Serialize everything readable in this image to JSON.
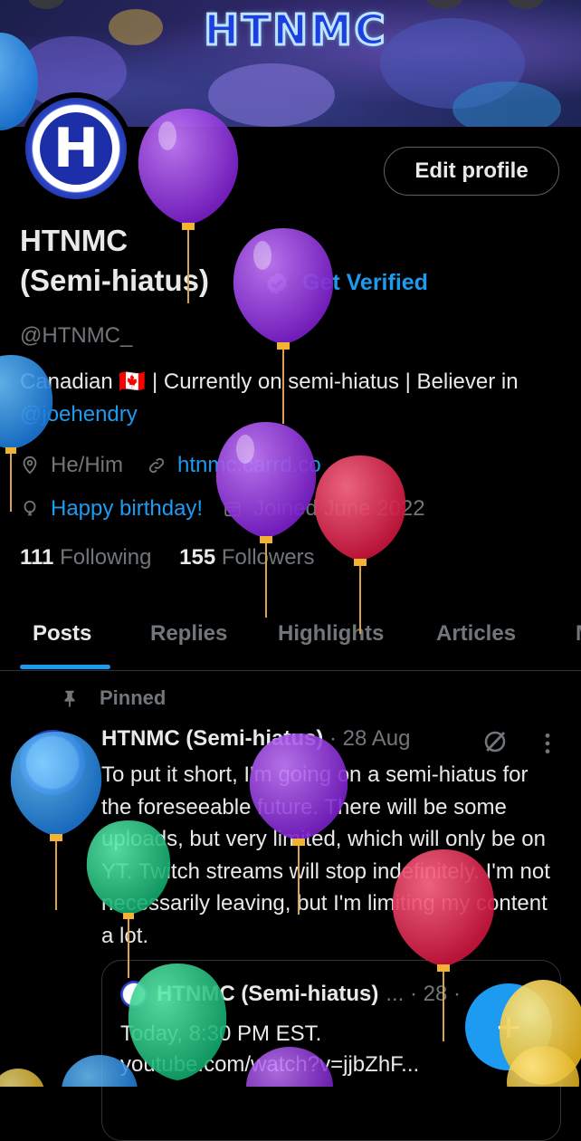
{
  "banner": {
    "logo_text": "HTNMC"
  },
  "profile": {
    "edit_button": "Edit profile",
    "name_line1": "HTNMC",
    "name_line2": "(Semi-hiatus)",
    "get_verified": "Get Verified",
    "handle": "@HTNMC_",
    "bio_prefix": "Canadian 🇨🇦 | Currently on semi-hiatus | Believer in ",
    "bio_mention": "@joehendry",
    "pronouns": "He/Him",
    "website": "htnmc.carrd.co",
    "birthday": "Happy birthday!",
    "joined": "Joined June 2022",
    "following_count": "111",
    "following_label": "Following",
    "followers_count": "155",
    "followers_label": "Followers"
  },
  "tabs": [
    "Posts",
    "Replies",
    "Highlights",
    "Articles",
    "M"
  ],
  "post": {
    "pinned_label": "Pinned",
    "author": "HTNMC (Semi-hiatus)",
    "date": "· 28 Aug",
    "text": "To put it short, I'm going on a semi-hiatus for the foreseeable future. There will be some uploads, but very limited, which will only be on YT. Twitch streams will stop indefinitely. I'm not necessarily leaving, but I'm limiting my content a lot.",
    "quote": {
      "author": "HTNMC (Semi-hiatus)",
      "meta": "... · 28 ·",
      "line1": "Today, 8:30 PM EST.",
      "line2": "youtube.com/watch?v=jjbZhF..."
    }
  },
  "fab_label": "+",
  "colors": {
    "accent": "#1d9bf0",
    "muted": "#71767b",
    "text": "#e7e9ea"
  }
}
